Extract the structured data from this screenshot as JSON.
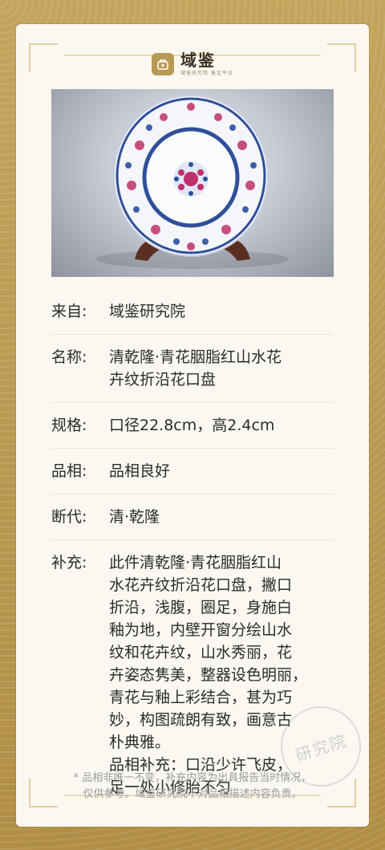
{
  "brand": {
    "title": "域鉴",
    "subtitle": "域鉴研究院 鉴定平台"
  },
  "image": {
    "alt_icon": "porcelain-plate-photo"
  },
  "details": [
    {
      "label": "来自:",
      "value": "域鉴研究院"
    },
    {
      "label": "名称:",
      "value": "清乾隆·青花胭脂红山水花\n卉纹折沿花口盘"
    },
    {
      "label": "规格:",
      "value": "口径22.8cm，高2.4cm"
    },
    {
      "label": "品相:",
      "value": "品相良好"
    },
    {
      "label": "断代:",
      "value": "清·乾隆"
    },
    {
      "label": "补充:",
      "value": "此件清乾隆·青花胭脂红山\n水花卉纹折沿花口盘，撇口\n折沿，浅腹，圈足，身施白\n釉为地，内壁开窗分绘山水\n纹和花卉纹，山水秀丽，花\n卉姿态隽美，整器设色明丽，\n青花与釉上彩结合，甚为巧\n妙，构图疏朗有致，画意古\n朴典雅。\n品相补充：口沿少许飞皮，\n足一处小修胎不匀"
    }
  ],
  "footnote": "* 品相非唯一不变，补充内容为出具报告当时情况，\n仅供参考。域鉴研究院不对品相描述内容负责。",
  "stamp": "研究院"
}
